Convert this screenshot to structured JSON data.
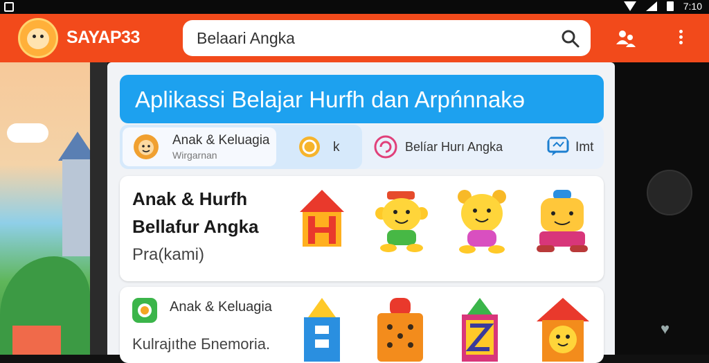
{
  "status_bar": {
    "time": "7:10"
  },
  "app_bar": {
    "brand": "SAYAP33",
    "search_value": "Belaari Angka",
    "icons": [
      "search-icon",
      "people-icon",
      "more-vert-icon"
    ]
  },
  "banner": {
    "title": "Aplikassi Belajar Hurfh dan Arpńnnakə"
  },
  "tabs": [
    {
      "label": "Anak & Keluagia",
      "sublabel": "Wirgarnan",
      "icon": "lion-icon"
    },
    {
      "label": "k",
      "icon": "coin-icon"
    },
    {
      "label": "Belíar Hurı Angka",
      "icon": "refresh-circle-icon"
    },
    {
      "label": "Imt",
      "icon": "chat-icon"
    }
  ],
  "cards": [
    {
      "title_line1": "Anak & Hurfh",
      "title_line2": "Bellafur Angka",
      "subtitle": "Pra(kami)",
      "stickers": [
        "house-letter-h-icon",
        "yellow-monkey-icon",
        "yellow-bear-icon",
        "orange-robot-icon"
      ]
    },
    {
      "label": "Anak & Keluagia",
      "subtitle": "Kulrajıthe Ƃnemoria.",
      "stickers": [
        "blue-block-tower-icon",
        "orange-dice-block-icon",
        "letter-z-block-icon",
        "house-face-icon"
      ]
    }
  ],
  "colors": {
    "app_bar": "#f24a1b",
    "banner": "#1da1ef",
    "screen_bg": "#f1f3f6"
  }
}
